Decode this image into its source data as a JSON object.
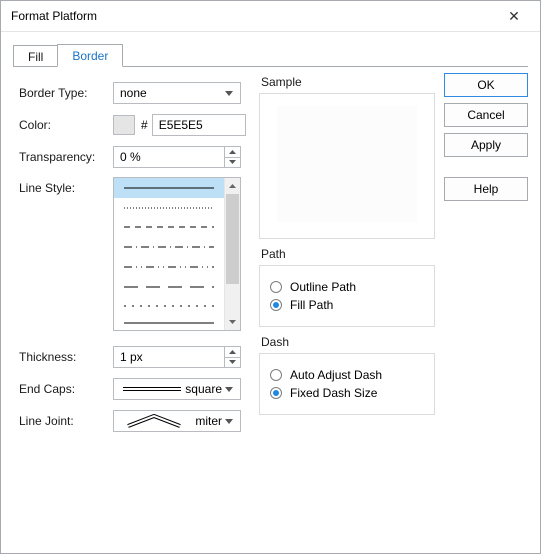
{
  "window": {
    "title": "Format Platform"
  },
  "tabs": {
    "fill": "Fill",
    "border": "Border"
  },
  "labels": {
    "border_type": "Border Type:",
    "color": "Color:",
    "transparency": "Transparency:",
    "line_style": "Line Style:",
    "thickness": "Thickness:",
    "end_caps": "End Caps:",
    "line_joint": "Line Joint:",
    "sample": "Sample",
    "path": "Path",
    "dash": "Dash"
  },
  "values": {
    "border_type": "none",
    "hex": "E5E5E5",
    "transparency": "0 %",
    "thickness": "1 px",
    "end_caps": "square",
    "line_joint": "miter"
  },
  "path_options": {
    "outline": "Outline Path",
    "fill": "Fill Path"
  },
  "dash_options": {
    "auto": "Auto Adjust Dash",
    "fixed": "Fixed Dash Size"
  },
  "buttons": {
    "ok": "OK",
    "cancel": "Cancel",
    "apply": "Apply",
    "help": "Help"
  },
  "icons": {
    "hash": "#",
    "close": "✕"
  }
}
